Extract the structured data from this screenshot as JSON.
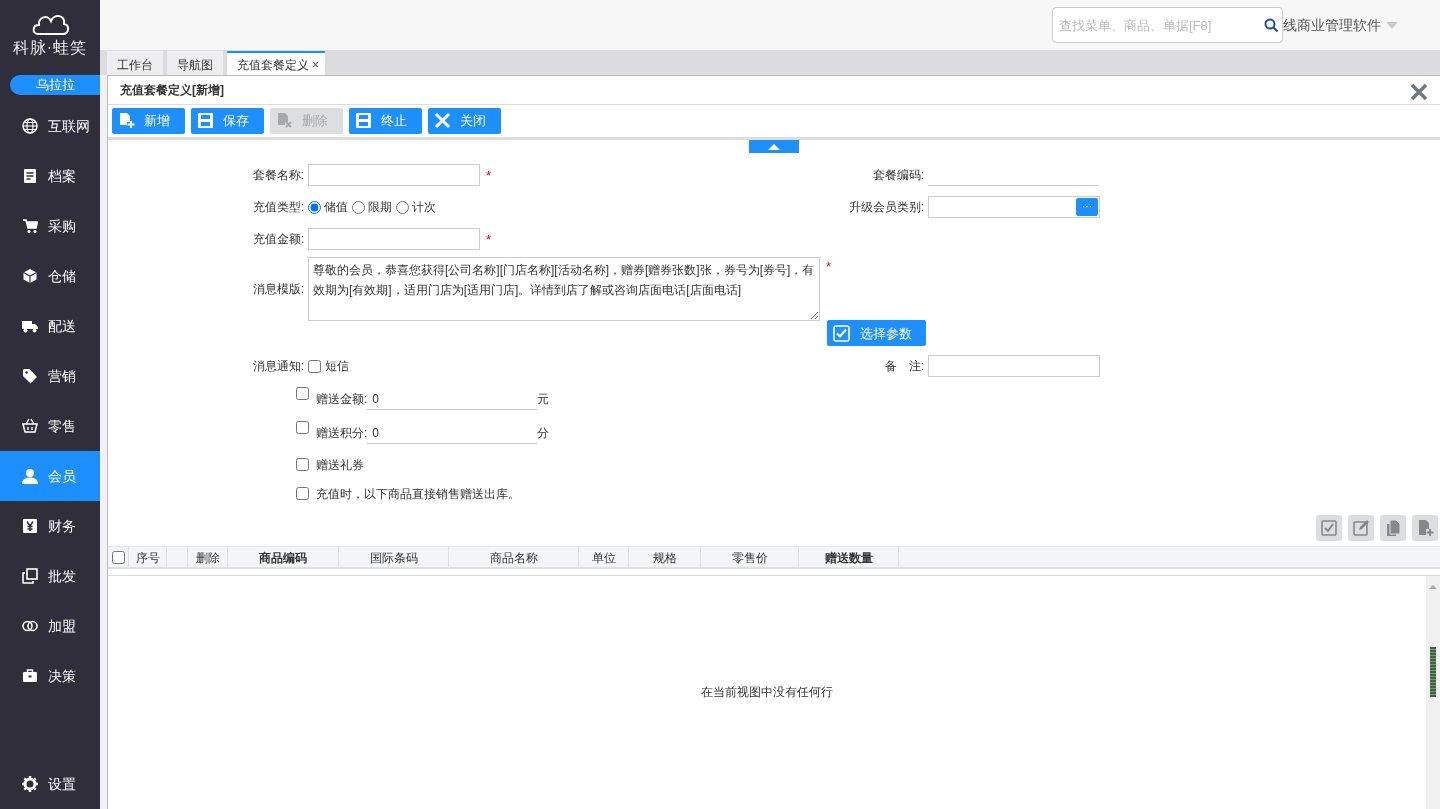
{
  "sidebar": {
    "logo_text": "科脉·蛙笑",
    "user": "乌拉拉",
    "items": [
      {
        "label": "互联网",
        "selected": false
      },
      {
        "label": "档案",
        "selected": false
      },
      {
        "label": "采购",
        "selected": false
      },
      {
        "label": "仓储",
        "selected": false
      },
      {
        "label": "配送",
        "selected": false
      },
      {
        "label": "营销",
        "selected": false
      },
      {
        "label": "零售",
        "selected": false
      },
      {
        "label": "会员",
        "selected": true
      },
      {
        "label": "财务",
        "selected": false
      },
      {
        "label": "批发",
        "selected": false
      },
      {
        "label": "加盟",
        "selected": false
      },
      {
        "label": "决策",
        "selected": false
      }
    ],
    "settings": "设置"
  },
  "header": {
    "search": {
      "placeholder": "查找菜单、商品、单据[F8]"
    },
    "product_menu": "线商业管理软件"
  },
  "tabs": [
    {
      "label": "工作台",
      "selected": false,
      "closable": false
    },
    {
      "label": "导航图",
      "selected": false,
      "closable": false
    },
    {
      "label": "充值套餐定义",
      "selected": true,
      "closable": true
    }
  ],
  "tab_close": "×",
  "panel": {
    "title": "充值套餐定义[新增]"
  },
  "toolbar": [
    {
      "label": "新增",
      "disabled": false
    },
    {
      "label": "保存",
      "disabled": false
    },
    {
      "label": "删除",
      "disabled": true
    },
    {
      "label": "终止",
      "disabled": false
    },
    {
      "label": "关闭",
      "disabled": false
    }
  ],
  "form": {
    "name": {
      "label": "套餐名称:",
      "required": true
    },
    "code": {
      "label": "套餐编码:"
    },
    "charge_type": {
      "label": "充值类型:",
      "options": [
        {
          "label": "储值",
          "selected": true
        },
        {
          "label": "限期",
          "selected": false
        },
        {
          "label": "计次",
          "selected": false
        }
      ]
    },
    "upgrade_level": {
      "label": "升级会员类别:",
      "picker": "···"
    },
    "amount": {
      "label": "充值金额:",
      "required": true
    },
    "template": {
      "label": "消息模版:",
      "value": "尊敬的会员，恭喜您获得[公司名称][门店名称][活动名称]，赠券[赠券张数]张，券号为[券号]，有效期为[有效期]，适用门店为[适用门店]。详情到店了解或咨询店面电话[店面电话]",
      "required": true
    },
    "param_button": "选择参数",
    "notify": {
      "label": "消息通知:",
      "options": [
        {
          "label": "短信",
          "checked": false
        }
      ]
    },
    "remark": {
      "label": "备　注:"
    },
    "required_mark": "*",
    "gifts": [
      {
        "kind": "field",
        "label": "赠送金额:",
        "checked": false,
        "value": "0",
        "unit": "元"
      },
      {
        "kind": "field",
        "label": "赠送积分:",
        "checked": false,
        "value": "0",
        "unit": "分"
      },
      {
        "kind": "plain",
        "label": "赠送礼券",
        "checked": false
      },
      {
        "kind": "plain",
        "label": "充值时，以下商品直接销售赠送出库。",
        "checked": false
      }
    ]
  },
  "grid": {
    "select_all": {
      "checked": false
    },
    "columns": [
      {
        "label": "序号",
        "bold": false
      },
      {
        "label": "删除",
        "bold": false
      },
      {
        "label": "商品编码",
        "bold": true
      },
      {
        "label": "国际条码",
        "bold": false
      },
      {
        "label": "商品名称",
        "bold": false
      },
      {
        "label": "单位",
        "bold": false
      },
      {
        "label": "规格",
        "bold": false
      },
      {
        "label": "零售价",
        "bold": false
      },
      {
        "label": "赠送数量",
        "bold": true
      }
    ],
    "empty_text": "在当前视图中没有任何行"
  }
}
